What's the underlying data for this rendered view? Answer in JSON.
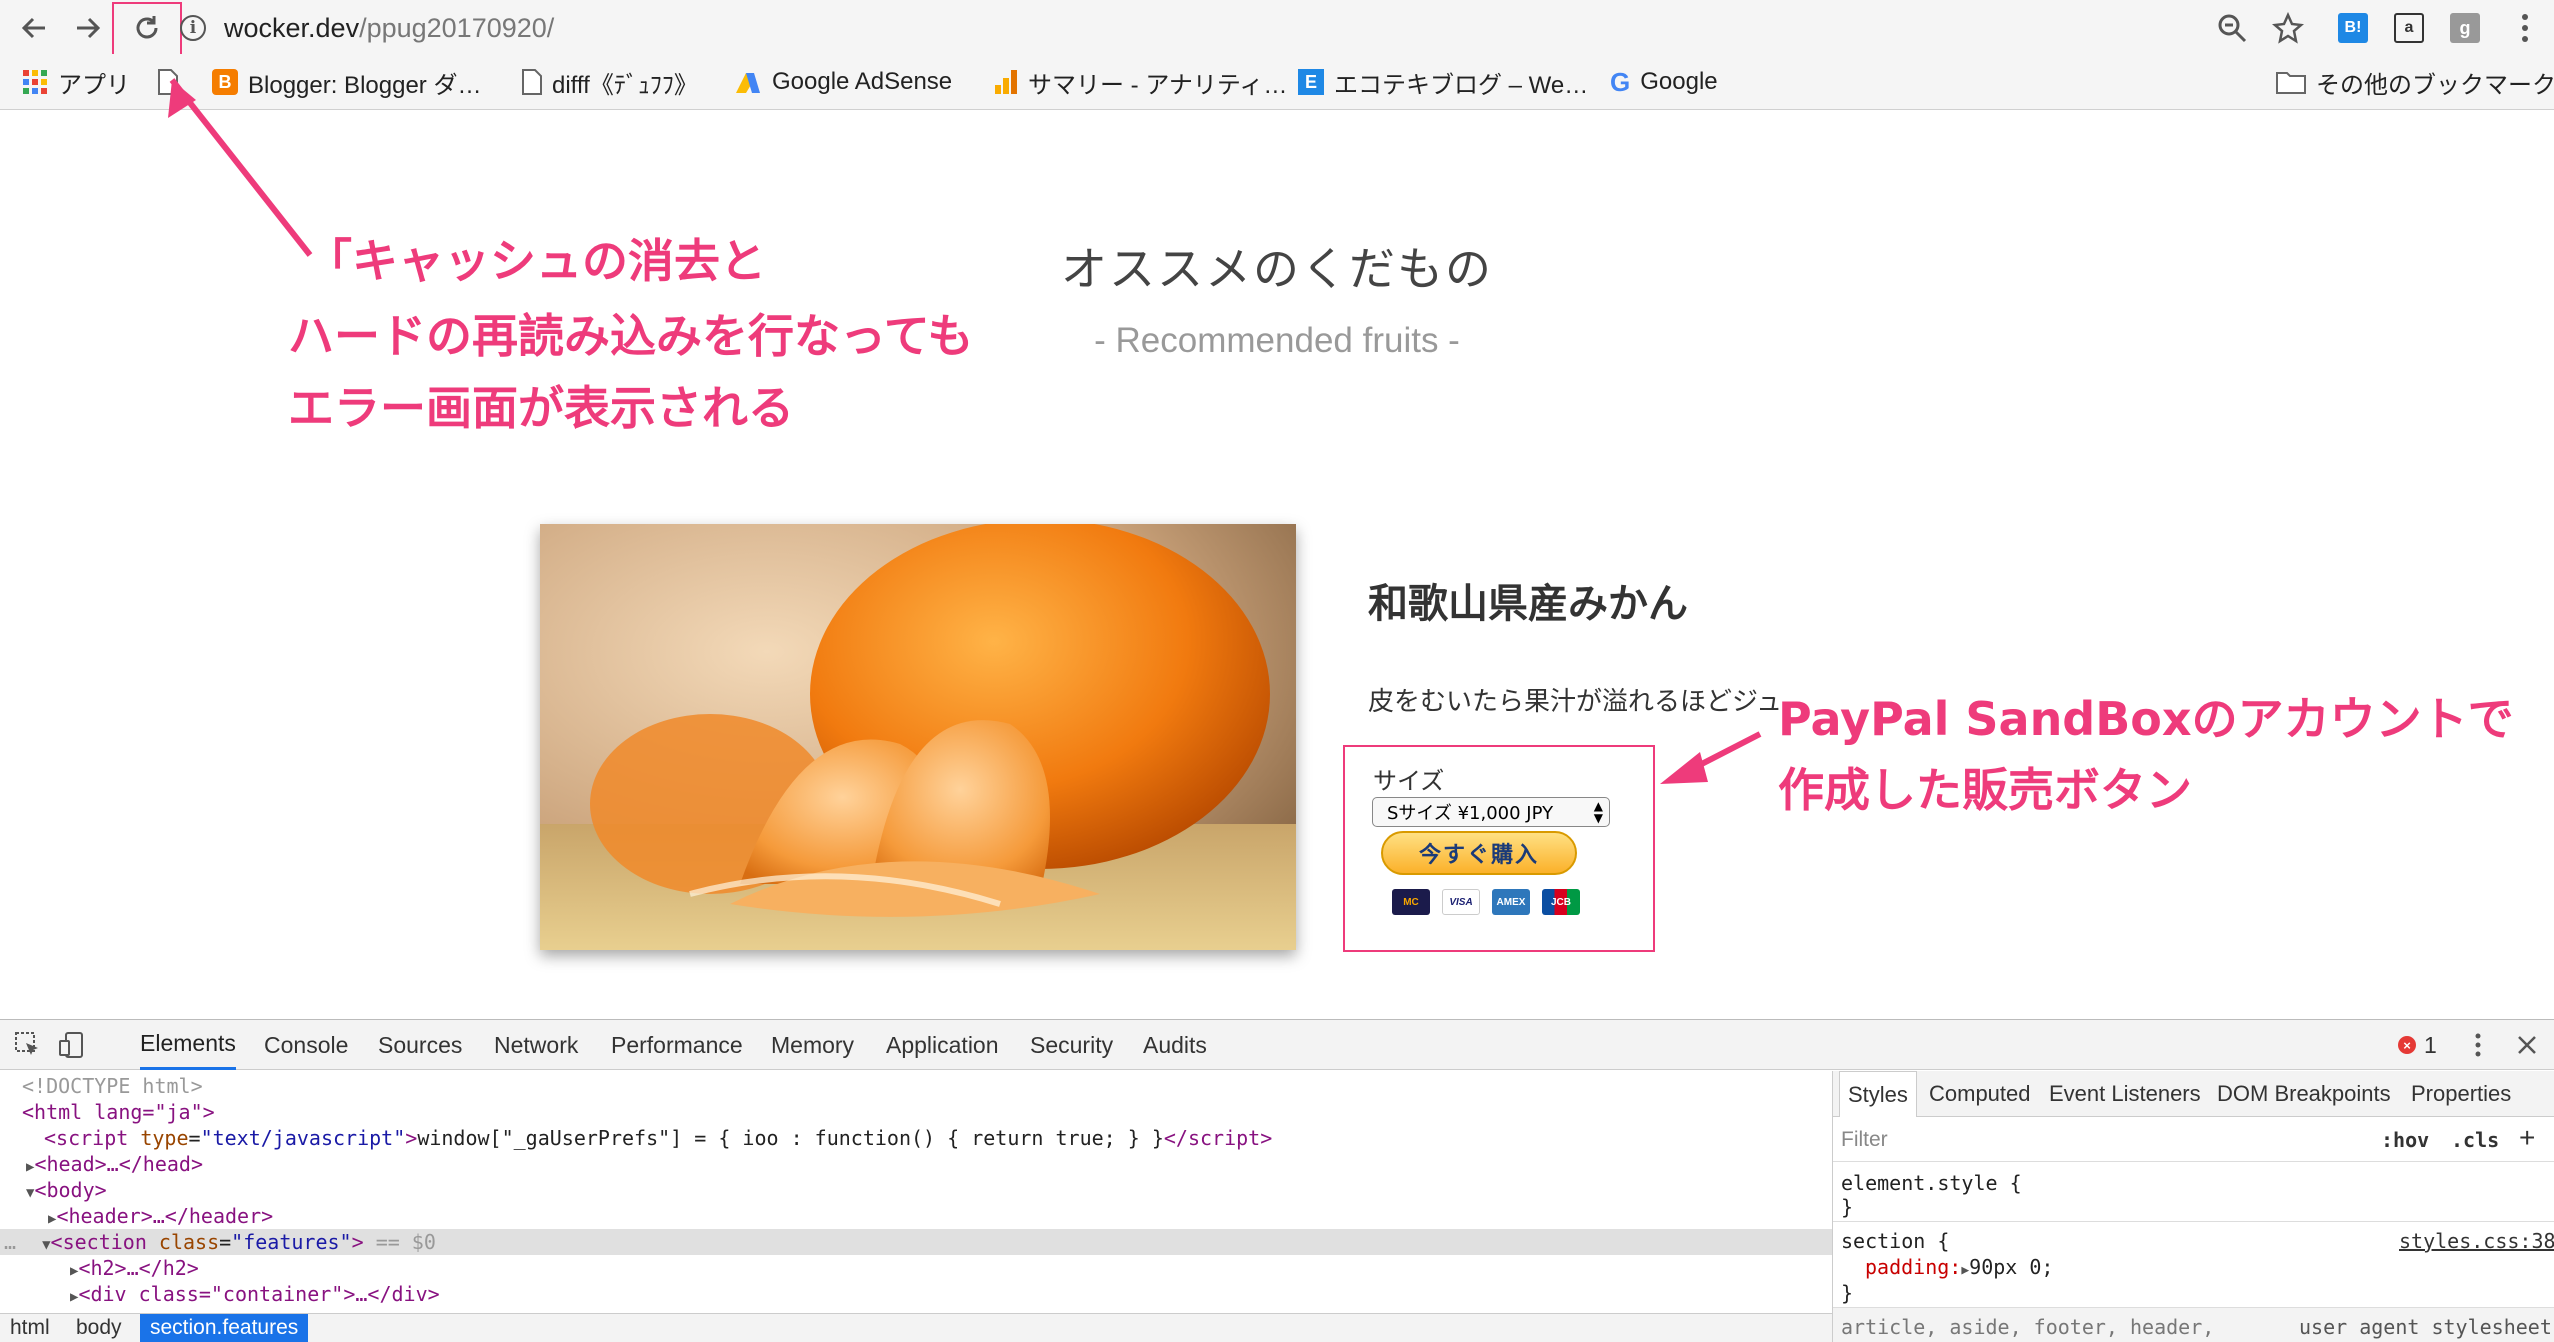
{
  "browser": {
    "url_host": "wocker.dev",
    "url_path": "/ppug20170920/",
    "bookmarks": [
      {
        "label": "アプリ"
      },
      {
        "label": "Blogger: Blogger ダ…"
      },
      {
        "label": "difff《ﾃﾞｭﾌﾌ》"
      },
      {
        "label": "Google AdSense"
      },
      {
        "label": "サマリー - アナリティ…"
      },
      {
        "label": "エコテキブログ – We…"
      },
      {
        "label": "Google"
      }
    ],
    "other_bookmarks": "その他のブックマーク"
  },
  "page": {
    "heading": "オススメのくだもの",
    "subheading": "- Recommended fruits -",
    "product_title": "和歌山県産みかん",
    "product_desc": "皮をむいたら果汁が溢れるほどジュ…",
    "paypal": {
      "size_label": "サイズ",
      "size_option": "Sサイズ ¥1,000 JPY",
      "buy_label": "今すぐ購入",
      "cards": [
        "MC",
        "VISA",
        "AMEX",
        "JCB"
      ]
    }
  },
  "annotations": {
    "reload_note": [
      "「キャッシュの消去と",
      "ハードの再読み込みを行なっても",
      "エラー画面が表示される"
    ],
    "paypal_note": [
      "PayPal SandBoxのアカウントで",
      "作成した販売ボタン"
    ]
  },
  "devtools": {
    "tabs": [
      "Elements",
      "Console",
      "Sources",
      "Network",
      "Performance",
      "Memory",
      "Application",
      "Security",
      "Audits"
    ],
    "error_count": "1",
    "dom": {
      "doctype": "<!DOCTYPE html>",
      "html_open": "<html lang=\"ja\">",
      "script_line": "window[\"_gaUserPrefs\"] = { ioo : function() { return true; } }",
      "head": "<head>…</head>",
      "body": "<body>",
      "header": "<header>…</header>",
      "section_marker": "== $0",
      "h2": "<h2>…</h2>",
      "div": "<div class=\"container\">…</div>"
    },
    "breadcrumbs": [
      "html",
      "body",
      "section.features"
    ],
    "styles_tabs": [
      "Styles",
      "Computed",
      "Event Listeners",
      "DOM Breakpoints",
      "Properties"
    ],
    "filter_placeholder": "Filter",
    "hov": ":hov",
    "cls": ".cls",
    "styles": {
      "element_style": "element.style {",
      "close": "}",
      "section_selector": "section {",
      "padding_prop": "padding:",
      "padding_val": "90px 0;",
      "source": "styles.css:38",
      "next_rule": "article, aside, footer, header,",
      "ua": "user agent stylesheet"
    }
  },
  "colors": {
    "annotation": "#ee3b7b",
    "active_tab": "#1a73e8"
  }
}
